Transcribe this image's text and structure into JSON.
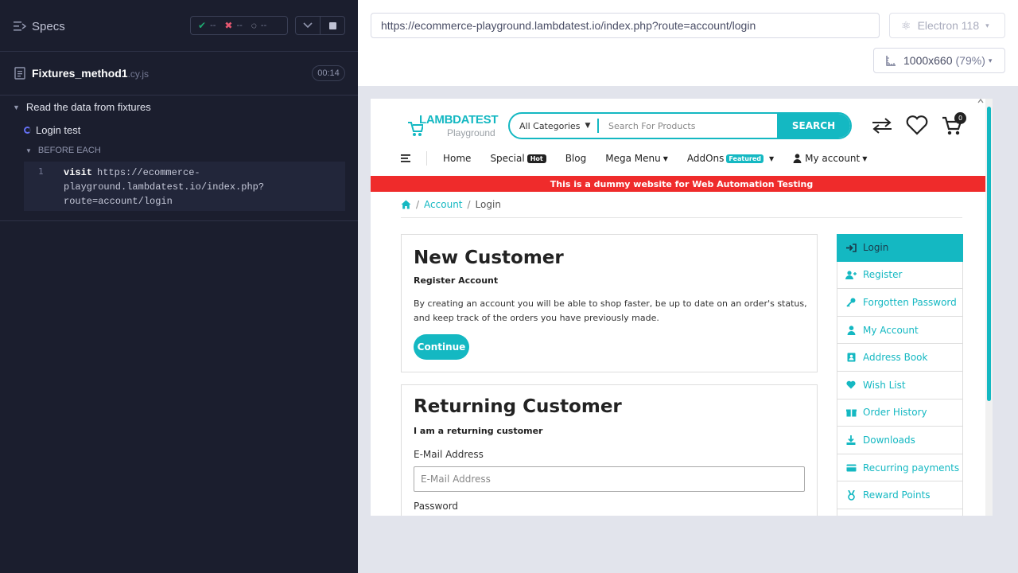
{
  "runner": {
    "specs_label": "Specs",
    "stats": {
      "passed": "--",
      "failed": "--",
      "pending": "--"
    },
    "spec": {
      "name": "Fixtures_method1",
      "ext": ".cy.js",
      "duration": "00:14"
    },
    "suite": "Read the data from fixtures",
    "test": "Login test",
    "hook": "BEFORE EACH",
    "command": {
      "num": "1",
      "name": "visit",
      "arg_lines": [
        "https://ecommerce-",
        "playground.lambdatest.io/index.php?",
        "route=account/login"
      ]
    }
  },
  "aut": {
    "url": "https://ecommerce-playground.lambdatest.io/index.php?route=account/login",
    "browser": "Electron 118",
    "viewport": "1000x660",
    "zoom": "(79%)"
  },
  "site": {
    "logo_main": "LAMBDATEST",
    "logo_sub": "Playground",
    "search": {
      "category": "All Categories",
      "placeholder": "Search For Products",
      "button": "SEARCH"
    },
    "cart_count": "0",
    "nav": {
      "home": "Home",
      "special": "Special",
      "hot": "Hot",
      "blog": "Blog",
      "mega_menu": "Mega Menu",
      "addons": "AddOns",
      "featured": "Featured",
      "my_account": "My account"
    },
    "banner": "This is a dummy website for Web Automation Testing",
    "breadcrumb": [
      "Account",
      "Login"
    ],
    "new_customer": {
      "title": "New Customer",
      "subtitle": "Register Account",
      "text": "By creating an account you will be able to shop faster, be up to date on an order's status, and keep track of the orders you have previously made.",
      "button": "Continue"
    },
    "returning": {
      "title": "Returning Customer",
      "subtitle": "I am a returning customer",
      "email_label": "E-Mail Address",
      "email_placeholder": "E-Mail Address",
      "password_label": "Password"
    },
    "account_menu": [
      "Login",
      "Register",
      "Forgotten Password",
      "My Account",
      "Address Book",
      "Wish List",
      "Order History",
      "Downloads",
      "Recurring payments",
      "Reward Points"
    ]
  },
  "colors": {
    "accent": "#14b8c2",
    "banner": "#ef2b2b",
    "runner_bg": "#1b1e2e"
  }
}
